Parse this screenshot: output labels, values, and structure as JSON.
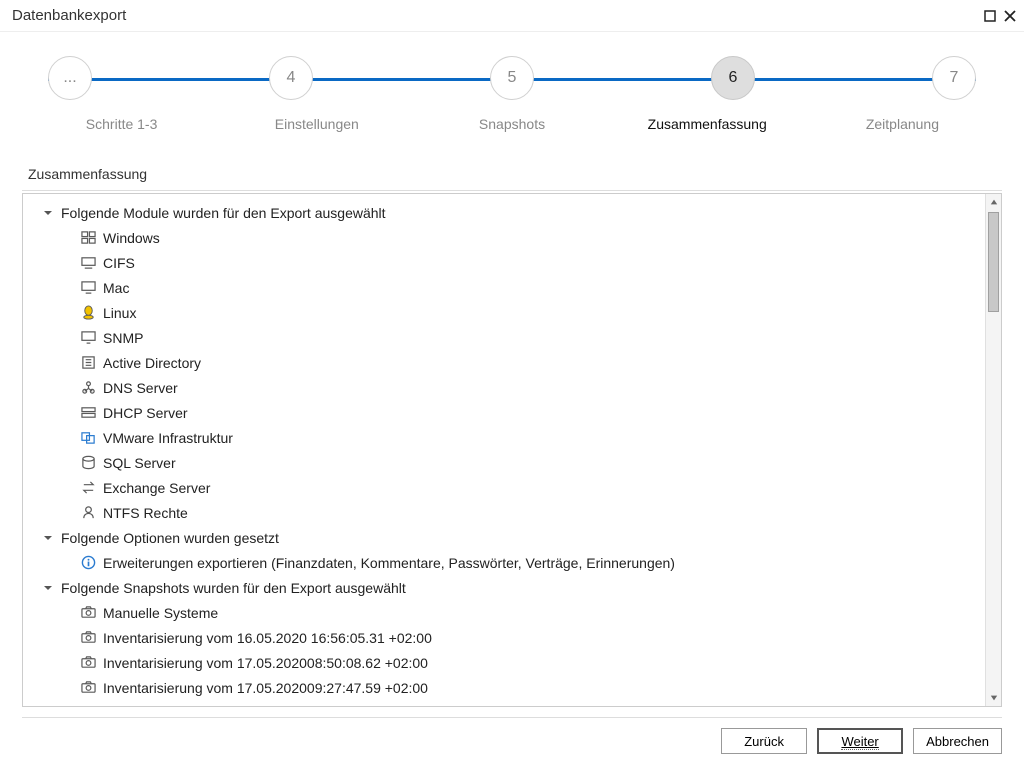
{
  "window": {
    "title": "Datenbankexport"
  },
  "stepper": {
    "steps": [
      {
        "circle": "...",
        "label": "Schritte 1-3",
        "active": false
      },
      {
        "circle": "4",
        "label": "Einstellungen",
        "active": false
      },
      {
        "circle": "5",
        "label": "Snapshots",
        "active": false
      },
      {
        "circle": "6",
        "label": "Zusammenfassung",
        "active": true
      },
      {
        "circle": "7",
        "label": "Zeitplanung",
        "active": false
      }
    ]
  },
  "section_title": "Zusammenfassung",
  "tree": {
    "sections": [
      {
        "header": "Folgende Module wurden für den Export ausgewählt",
        "items": [
          {
            "icon": "windows",
            "label": "Windows"
          },
          {
            "icon": "cifs",
            "label": "CIFS"
          },
          {
            "icon": "mac",
            "label": "Mac"
          },
          {
            "icon": "linux",
            "label": "Linux"
          },
          {
            "icon": "snmp",
            "label": "SNMP"
          },
          {
            "icon": "ad",
            "label": "Active Directory"
          },
          {
            "icon": "dns",
            "label": "DNS Server"
          },
          {
            "icon": "dhcp",
            "label": "DHCP Server"
          },
          {
            "icon": "vmware",
            "label": "VMware Infrastruktur"
          },
          {
            "icon": "sql",
            "label": "SQL Server"
          },
          {
            "icon": "exchange",
            "label": "Exchange Server"
          },
          {
            "icon": "ntfs",
            "label": "NTFS Rechte"
          }
        ]
      },
      {
        "header": "Folgende Optionen wurden gesetzt",
        "items": [
          {
            "icon": "info",
            "label": "Erweiterungen exportieren (Finanzdaten, Kommentare, Passwörter, Verträge, Erinnerungen)"
          }
        ]
      },
      {
        "header": "Folgende Snapshots wurden für den Export ausgewählt",
        "items": [
          {
            "icon": "snapshot",
            "label": "Manuelle Systeme"
          },
          {
            "icon": "snapshot",
            "label": "Inventarisierung vom 16.05.2020 16:56:05.31 +02:00"
          },
          {
            "icon": "snapshot",
            "label": "Inventarisierung vom 17.05.202008:50:08.62 +02:00"
          },
          {
            "icon": "snapshot",
            "label": "Inventarisierung vom 17.05.202009:27:47.59 +02:00"
          }
        ]
      }
    ]
  },
  "footer": {
    "back": "Zurück",
    "next": "Weiter",
    "cancel": "Abbrechen"
  }
}
